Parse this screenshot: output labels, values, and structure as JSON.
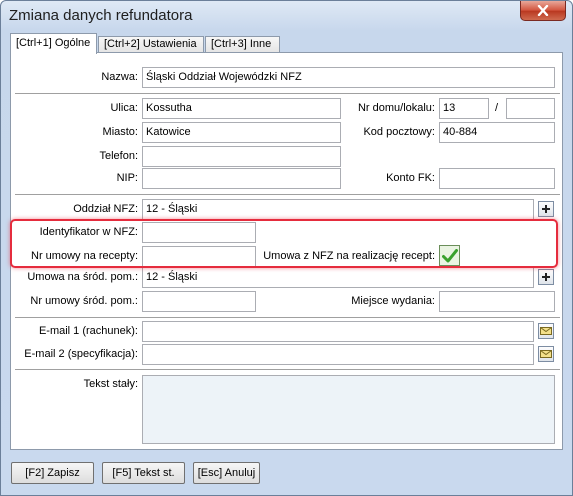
{
  "window": {
    "title": "Zmiana danych refundatora",
    "close_icon": "close-icon"
  },
  "tabs": [
    {
      "label": "[Ctrl+1] Ogólne",
      "active": true
    },
    {
      "label": "[Ctrl+2] Ustawienia",
      "active": false
    },
    {
      "label": "[Ctrl+3] Inne",
      "active": false
    }
  ],
  "form": {
    "nazwa": {
      "label": "Nazwa:",
      "value": "Śląski Oddział Wojewódzki NFZ"
    },
    "ulica": {
      "label": "Ulica:",
      "value": "Kossutha"
    },
    "nr_domu": {
      "label": "Nr domu/lokalu:",
      "value": "13",
      "separator": "/",
      "lokal": ""
    },
    "miasto": {
      "label": "Miasto:",
      "value": "Katowice"
    },
    "kod": {
      "label": "Kod pocztowy:",
      "value": "40-884"
    },
    "telefon": {
      "label": "Telefon:",
      "value": ""
    },
    "nip": {
      "label": "NIP:",
      "value": ""
    },
    "konto": {
      "label": "Konto FK:",
      "value": ""
    },
    "oddzial": {
      "label": "Oddział NFZ:",
      "value": "12 - Śląski"
    },
    "identyfikator": {
      "label": "Identyfikator w NFZ:",
      "value": ""
    },
    "nr_umowy_recepty": {
      "label": "Nr umowy na recepty:",
      "value": ""
    },
    "umowa_recept": {
      "label": "Umowa z NFZ na realizację recept:",
      "checked": true
    },
    "umowa_srod": {
      "label": "Umowa na śród. pom.:",
      "value": "12 - Śląski"
    },
    "nr_umowy_srod": {
      "label": "Nr umowy śród. pom.:",
      "value": ""
    },
    "miejsce": {
      "label": "Miejsce wydania:",
      "value": ""
    },
    "email1": {
      "label": "E-mail 1 (rachunek):",
      "value": ""
    },
    "email2": {
      "label": "E-mail 2 (specyfikacja):",
      "value": ""
    },
    "tekst": {
      "label": "Tekst stały:",
      "value": ""
    }
  },
  "buttons": {
    "zapisz": "[F2] Zapisz",
    "tekst": "[F5] Tekst st.",
    "anuluj": "[Esc] Anuluj"
  },
  "colors": {
    "highlight": "#e52c3d",
    "check": "#3aa12d"
  }
}
